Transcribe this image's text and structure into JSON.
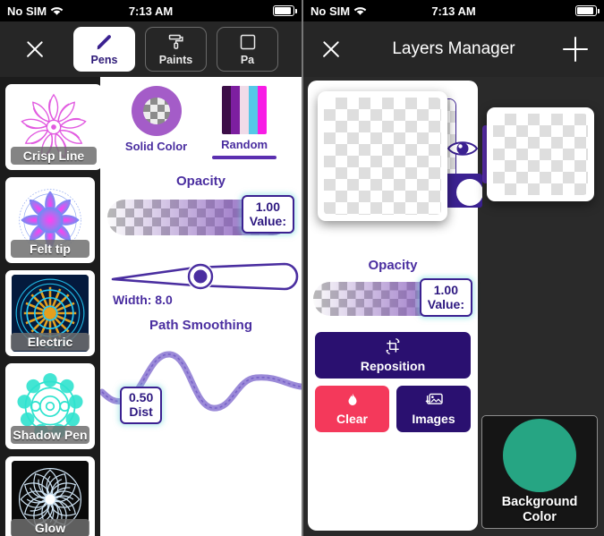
{
  "status_bar": {
    "carrier": "No SIM",
    "time": "7:13 AM",
    "wifi_icon": "wifi-icon",
    "battery_icon": "battery-icon"
  },
  "left_phone": {
    "nav": {
      "close_icon": "close-icon",
      "tabs": [
        {
          "label": "Pens",
          "icon": "pen-icon",
          "active": true
        },
        {
          "label": "Paints",
          "icon": "paint-roller-icon",
          "active": false
        },
        {
          "label": "Pa",
          "icon": "pattern-icon",
          "active": false
        }
      ]
    },
    "brushes": [
      {
        "label": "Crisp Line",
        "selected": true
      },
      {
        "label": "Felt tip",
        "selected": false
      },
      {
        "label": "Electric",
        "selected": false
      },
      {
        "label": "Shadow\nPen",
        "selected": false
      },
      {
        "label": "Glow",
        "selected": false
      }
    ],
    "brush_labels": {
      "crisp_line": "Crisp Line",
      "felt_tip": "Felt tip",
      "electric": "Electric",
      "shadow_pen": "Shadow Pen",
      "glow": "Glow"
    },
    "color_modes": [
      {
        "label": "Solid Color",
        "icon": "solid-color-swatch",
        "selected": false
      },
      {
        "label": "Random",
        "icon": "random-color-swatch",
        "selected": true
      }
    ],
    "random_swatch_colors": [
      "#3c0e47",
      "#7d1fa0",
      "#f0dbe8",
      "#55c8e8",
      "#f81ce5"
    ],
    "solid_swatch_ring": "#a45cc8",
    "opacity": {
      "title": "Opacity",
      "value": "1.00",
      "value_caption": "Value:"
    },
    "width": {
      "label": "Width: 8.0"
    },
    "path_smoothing": {
      "title": "Path Smoothing",
      "value": "0.50",
      "value_caption": "Dist"
    },
    "accent_color": "#4a2ea0"
  },
  "right_phone": {
    "nav": {
      "close_icon": "close-icon",
      "title": "Layers Manager",
      "add_icon": "plus-icon"
    },
    "layers": {
      "visibility_icon": "eye-icon",
      "dragged_layer": "transparent-layer-thumbnail",
      "drag_handle": "drag-handle"
    },
    "opacity": {
      "title": "Opacity",
      "value": "1.00",
      "value_caption": "Value:"
    },
    "buttons": {
      "reposition": {
        "label": "Reposition",
        "icon": "reposition-icon",
        "color": "#2a1070"
      },
      "clear": {
        "label": "Clear",
        "icon": "flame-icon",
        "color": "#f4395b"
      },
      "images": {
        "label": "Images",
        "icon": "images-icon",
        "color": "#2a1070"
      }
    },
    "background_color": {
      "label_line1": "Background",
      "label_line2": "Color",
      "swatch": "#26a583"
    },
    "accent_color": "#4a2ea0"
  }
}
